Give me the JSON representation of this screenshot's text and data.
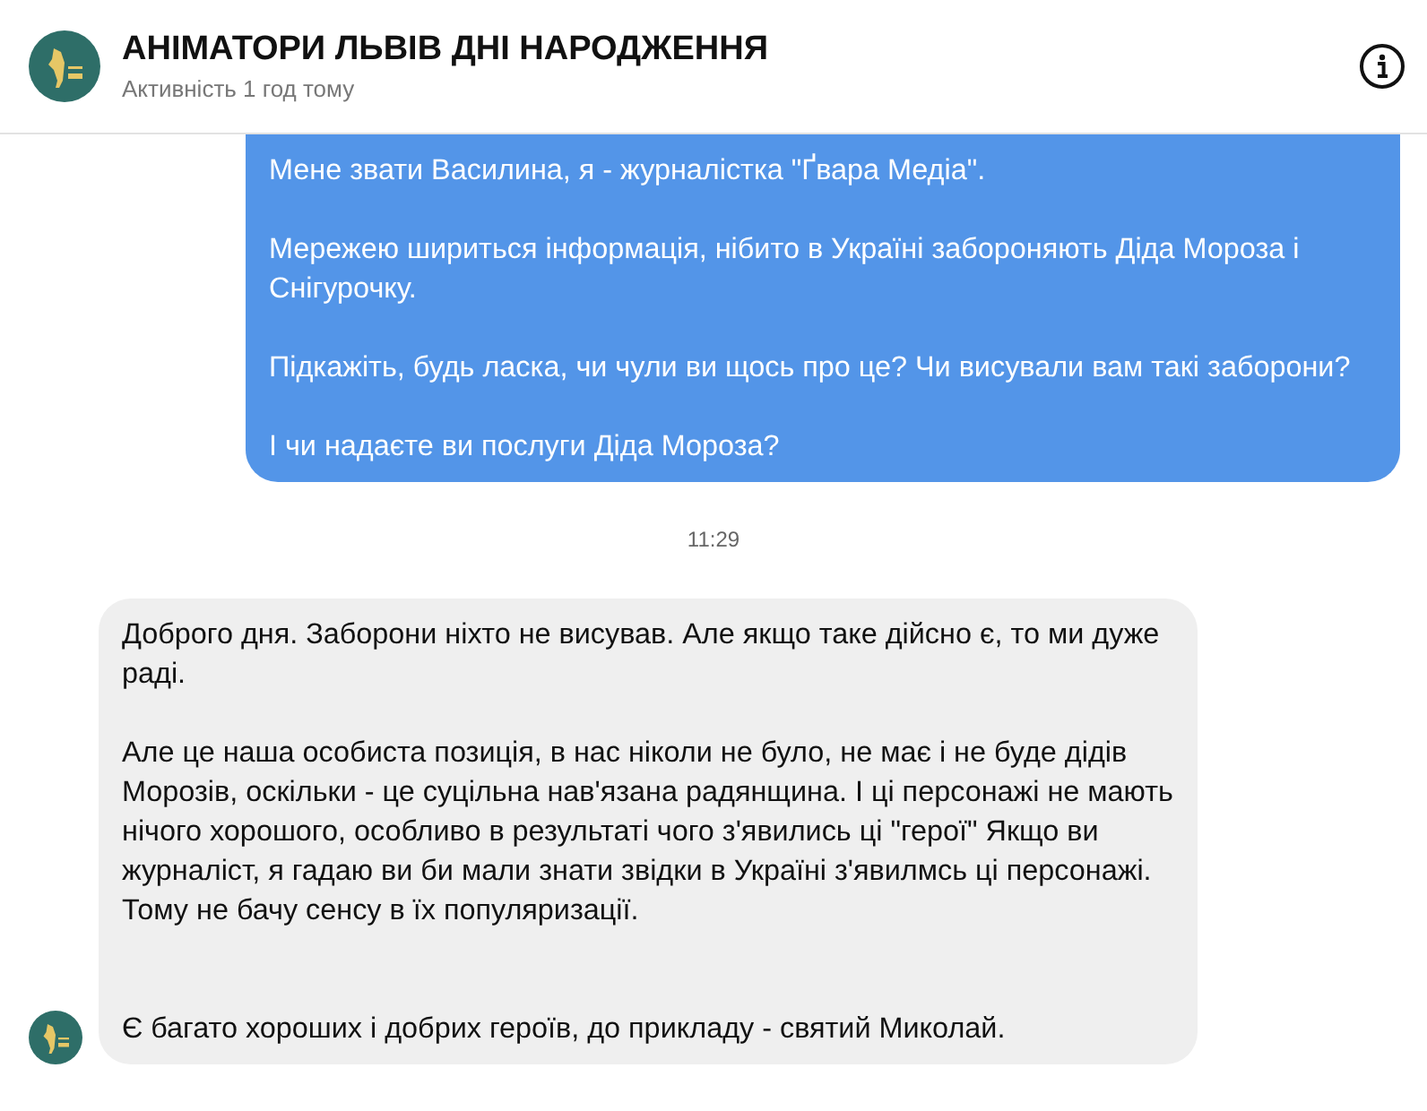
{
  "header": {
    "title": "АНІМАТОРИ ЛЬВІВ ДНІ НАРОДЖЕННЯ",
    "status": "Активність 1 год тому"
  },
  "messages": [
    {
      "kind": "outgoing",
      "paragraphs": [
        {
          "text": "Мене звати Василина, я - журналістка \"Ґвара Медіа\".",
          "kind": "normal"
        },
        {
          "text": "Мережею шириться інформація, нібито в Україні забороняють Діда Мороза і Снігурочку.",
          "kind": "normal"
        },
        {
          "text": "Підкажіть, будь ласка, чи чули ви щось про це? Чи висували вам такі заборони?",
          "kind": "normal"
        },
        {
          "text": "І чи надаєте ви послуги Діда Мороза?",
          "kind": "normal"
        }
      ]
    },
    {
      "kind": "time",
      "text": "11:29"
    },
    {
      "kind": "incoming",
      "paragraphs": [
        {
          "text": "Доброго дня. Заборони ніхто не висував. Але якщо таке дійсно є, то ми дуже раді.",
          "kind": "normal"
        },
        {
          "text": "Але це наша особиста позиція, в нас ніколи не було, не має і не буде дідів Морозів, оскільки - це суцільна нав'язана радянщина. І ці персонажі не мають нічого хорошого, особливо в результаті чого з'явились ці \"герої\" Якщо ви журналіст, я гадаю ви би мали знати звідки в Україні з'явилмсь ці персонажі. Тому не бачу сенсу в їх популяризації.",
          "kind": "normal"
        },
        {
          "text": "Є багато хороших і добрих героїв, до прикладу - святий Миколай.",
          "kind": "after_gap"
        }
      ]
    }
  ]
}
